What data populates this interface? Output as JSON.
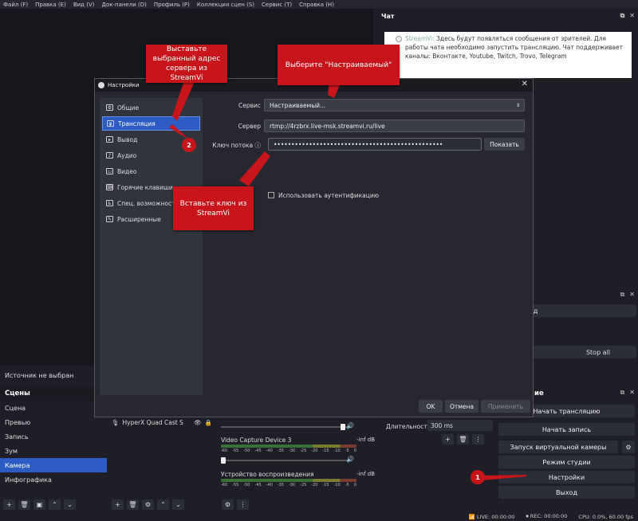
{
  "menubar": [
    "Файл (F)",
    "Правка (E)",
    "Вид (V)",
    "Док-панели (D)",
    "Профиль (P)",
    "Коллекция сцен (S)",
    "Сервис (T)",
    "Справка (H)"
  ],
  "chat": {
    "title": "Чат",
    "sender": "StreamVi:",
    "message": "Здесь будут появляться сообщения от зрителей. Для работы чата необходимо запустить трансляцию. Чат поддерживает каналы: Вконтакте, Youtube, Twitch, Trovo, Telegram"
  },
  "source_status": "Источник не выбран",
  "scenes": {
    "title": "Сцены",
    "items": [
      "Сцена",
      "Превью",
      "Запись",
      "Зум",
      "Камера",
      "Инфографика"
    ],
    "active": 4
  },
  "sources": {
    "item": "HyperX Quad Cast S"
  },
  "mixer": {
    "channels": [
      {
        "name": "Video Capture Device 3",
        "db": "-inf dB"
      },
      {
        "name": "Устройство воспроизведения",
        "db": "-inf dB"
      }
    ],
    "scale": [
      "-60",
      "-55",
      "-50",
      "-45",
      "-40",
      "-35",
      "-30",
      "-25",
      "-20",
      "-15",
      "-10",
      "-5",
      "0"
    ]
  },
  "transitions": {
    "duration_label": "Длительность",
    "duration_value": "300 ms"
  },
  "right_dock2": {
    "partial_label": "од",
    "stop_all": "Stop all"
  },
  "controls": {
    "title_partial": "ие",
    "start_stream": "Начать трансляцию",
    "start_record": "Начать запись",
    "virtual_cam": "Запуск виртуальной камеры",
    "studio_mode": "Режим студии",
    "settings": "Настройки",
    "exit": "Выход"
  },
  "statusbar": {
    "live": "LIVE: 00:00:00",
    "rec": "REC: 00:00:00",
    "cpu": "CPU: 0.0%, 60.00 fps"
  },
  "settings": {
    "title": "Настройки",
    "sidebar": [
      "Общие",
      "Трансляция",
      "Вывод",
      "Аудио",
      "Видео",
      "Горячие клавиши",
      "Спец. возможности",
      "Расширенные"
    ],
    "active": 1,
    "service_label": "Сервис",
    "service_value": "Настраиваемый...",
    "server_label": "Сервер",
    "server_value": "rtmp://4rzbrx.live-msk.streamvi.ru/live",
    "key_label": "Ключ потока",
    "key_value": "••••••••••••••••••••••••••••••••••••••••••••••••",
    "show_button": "Показать",
    "auth_checkbox": "Использовать аутентификацию",
    "ok": "OK",
    "cancel": "Отмена",
    "apply": "Применить"
  },
  "callouts": {
    "server": "Выставьте выбранный адрес сервера из StreamVi",
    "service": "Выберите \"Настраиваемый\"",
    "key": "Вставьте ключ из StreamVi",
    "badge1": "1",
    "badge2": "2"
  },
  "colors": {
    "accent": "#2d5bc4",
    "callout": "#c8151c",
    "background": "#1e1f26"
  }
}
